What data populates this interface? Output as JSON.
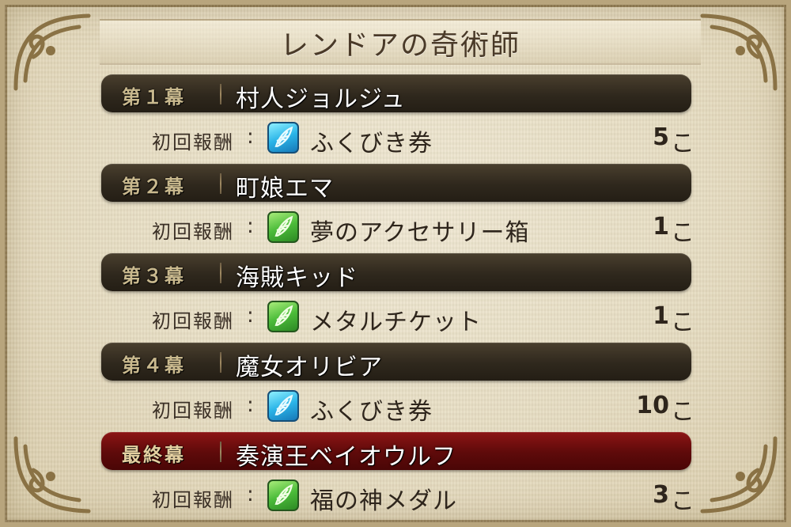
{
  "title": "レンドアの奇術師",
  "reward_label": "初回報酬",
  "colon": ":",
  "unit": "こ",
  "chapters": [
    {
      "act": "第１幕",
      "name": "村人ジョルジュ",
      "icon": "feather-ticket-icon",
      "icon_color": "blue",
      "item": "ふくびき券",
      "qty": "5",
      "final": false
    },
    {
      "act": "第２幕",
      "name": "町娘エマ",
      "icon": "feather-item-icon",
      "icon_color": "green",
      "item": "夢のアクセサリー箱",
      "qty": "1",
      "final": false
    },
    {
      "act": "第３幕",
      "name": "海賊キッド",
      "icon": "feather-item-icon",
      "icon_color": "green",
      "item": "メタルチケット",
      "qty": "1",
      "final": false
    },
    {
      "act": "第４幕",
      "name": "魔女オリビア",
      "icon": "feather-ticket-icon",
      "icon_color": "blue",
      "item": "ふくびき券",
      "qty": "10",
      "final": false
    },
    {
      "act": "最終幕",
      "name": "奏演王ベイオウルフ",
      "icon": "feather-item-icon",
      "icon_color": "green",
      "item": "福の神メダル",
      "qty": "3",
      "final": true
    }
  ],
  "colors": {
    "header_dark": "#2f281d",
    "header_final": "#5e0a0a",
    "parchment": "#e6dcc1"
  }
}
